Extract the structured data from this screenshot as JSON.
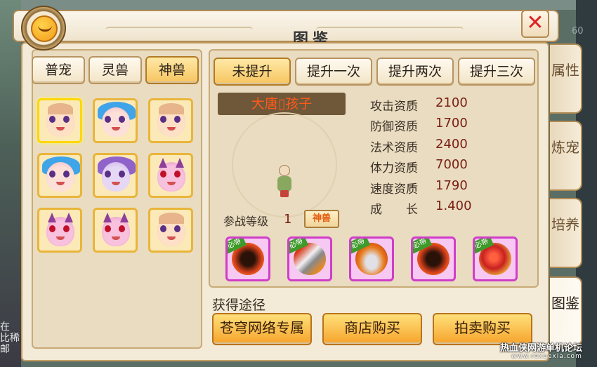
{
  "window": {
    "title": "图鉴",
    "close_glyph": "✕",
    "avatar_icon": "smiley-face-icon"
  },
  "category_tabs": [
    "普宠",
    "灵兽",
    "神兽"
  ],
  "active_category": "神兽",
  "upgrade_tabs": [
    "未提升",
    "提升一次",
    "提升两次",
    "提升三次"
  ],
  "active_upgrade": "未提升",
  "pets": [
    {
      "kind": "kid",
      "selected": true
    },
    {
      "kind": "fairy",
      "selected": false
    },
    {
      "kind": "kid",
      "selected": false
    },
    {
      "kind": "fairy",
      "selected": false
    },
    {
      "kind": "flower",
      "selected": false
    },
    {
      "kind": "imp",
      "selected": false
    },
    {
      "kind": "imp",
      "selected": false
    },
    {
      "kind": "imp",
      "selected": false
    },
    {
      "kind": "kid",
      "selected": false
    }
  ],
  "pet_name": "大唐▯孩子",
  "stats": [
    {
      "label": "攻击资质",
      "value": "2100"
    },
    {
      "label": "防御资质",
      "value": "1700"
    },
    {
      "label": "法术资质",
      "value": "2400"
    },
    {
      "label": "体力资质",
      "value": "7000"
    },
    {
      "label": "速度资质",
      "value": "1790"
    },
    {
      "label": "成　　长",
      "value": "1.400"
    }
  ],
  "battle_level": {
    "label": "参战等级",
    "value": "1",
    "badge": "神兽"
  },
  "skills": [
    {
      "tag": "必带",
      "icon": "fire-demon-skill-icon",
      "color": "#d8401c"
    },
    {
      "tag": "必带",
      "icon": "blade-slash-skill-icon",
      "color": "#b8b8c0"
    },
    {
      "tag": "必带",
      "icon": "whirlwind-blade-skill-icon",
      "color": "#e87a1a"
    },
    {
      "tag": "必带",
      "icon": "fire-demon-skill-icon",
      "color": "#d8401c"
    },
    {
      "tag": "必带",
      "icon": "flame-orb-skill-icon",
      "color": "#c82020"
    }
  ],
  "acquire": {
    "label": "获得途径",
    "buttons": [
      "苍穹网络专属",
      "商店购买",
      "拍卖购买"
    ]
  },
  "side_tabs": [
    {
      "label": "属性",
      "active": false
    },
    {
      "label": "炼宠",
      "active": false
    },
    {
      "label": "培养",
      "active": false
    },
    {
      "label": "图鉴",
      "active": true
    }
  ],
  "background_text": "在 比稀 邮",
  "background_number": "60",
  "watermark": {
    "title": "热血侠网游单机论坛",
    "url": "www.rexuexia.com"
  }
}
